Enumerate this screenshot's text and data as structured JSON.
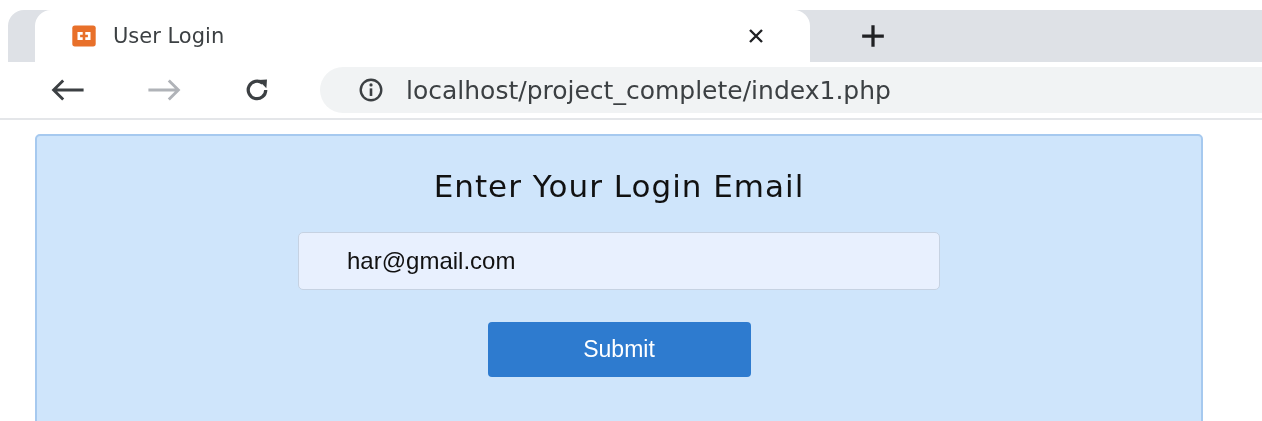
{
  "tabs": [
    {
      "title": "User Login",
      "selected": true
    }
  ],
  "address_bar": {
    "url": "localhost/project_complete/index1.php"
  },
  "navigation": {
    "back_disabled": false,
    "forward_disabled": true
  },
  "form": {
    "heading": "Enter Your Login Email",
    "email_field": {
      "value": "har@gmail.com"
    },
    "submit_button": "Submit"
  }
}
